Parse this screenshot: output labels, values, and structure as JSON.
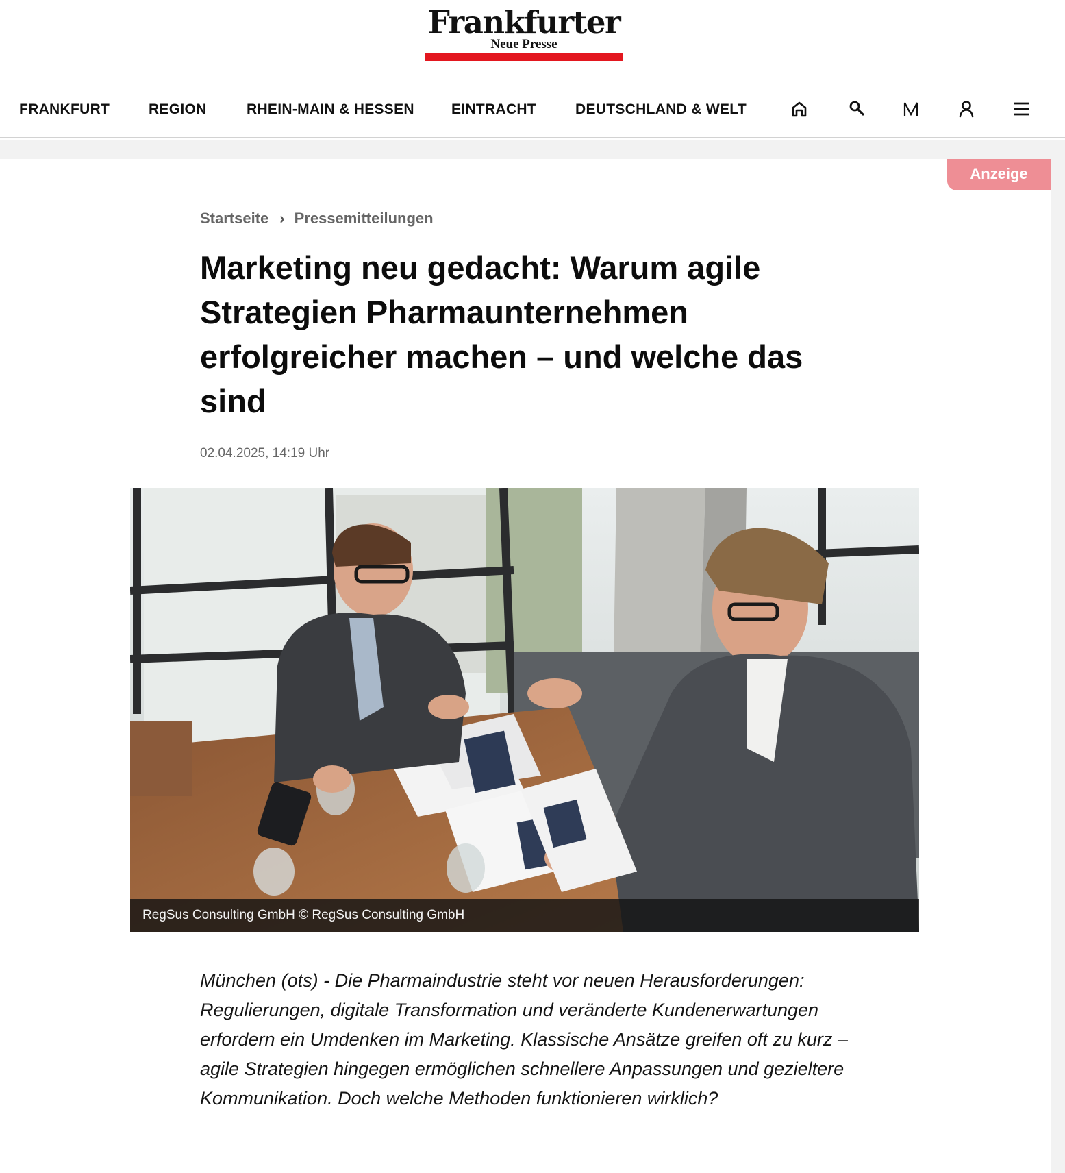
{
  "brand": {
    "name": "Frankfurter",
    "subline": "Neue Presse",
    "accent_color": "#e3171f"
  },
  "nav": {
    "items": [
      {
        "label": "FRANKFURT"
      },
      {
        "label": "REGION"
      },
      {
        "label": "RHEIN-MAIN & HESSEN"
      },
      {
        "label": "EINTRACHT"
      },
      {
        "label": "DEUTSCHLAND & WELT"
      }
    ],
    "icons": [
      "home-icon",
      "search-icon",
      "m-icon",
      "user-icon",
      "menu-icon"
    ]
  },
  "ad": {
    "label": "Anzeige",
    "color": "#ee8e95"
  },
  "breadcrumb": {
    "items": [
      "Startseite",
      "Pressemitteilungen"
    ],
    "separator": "›"
  },
  "article": {
    "title": "Marketing neu gedacht: Warum agile Strategien Pharmaunternehmen erfolgreicher machen – und welche das sind",
    "date": "02.04.2025, 14:19 Uhr",
    "image_caption": "RegSus Consulting GmbH © RegSus Consulting GmbH",
    "lead": "München (ots) - Die Pharmaindustrie steht vor neuen Herausforderungen: Regulierungen, digitale Transformation und veränderte Kundenerwartungen erfordern ein Umdenken im Marketing. Klassische Ansätze greifen oft zu kurz – agile Strategien hingegen ermöglichen schnellere Anpassungen und gezieltere Kommunikation. Doch welche Methoden funktionieren wirklich?"
  }
}
